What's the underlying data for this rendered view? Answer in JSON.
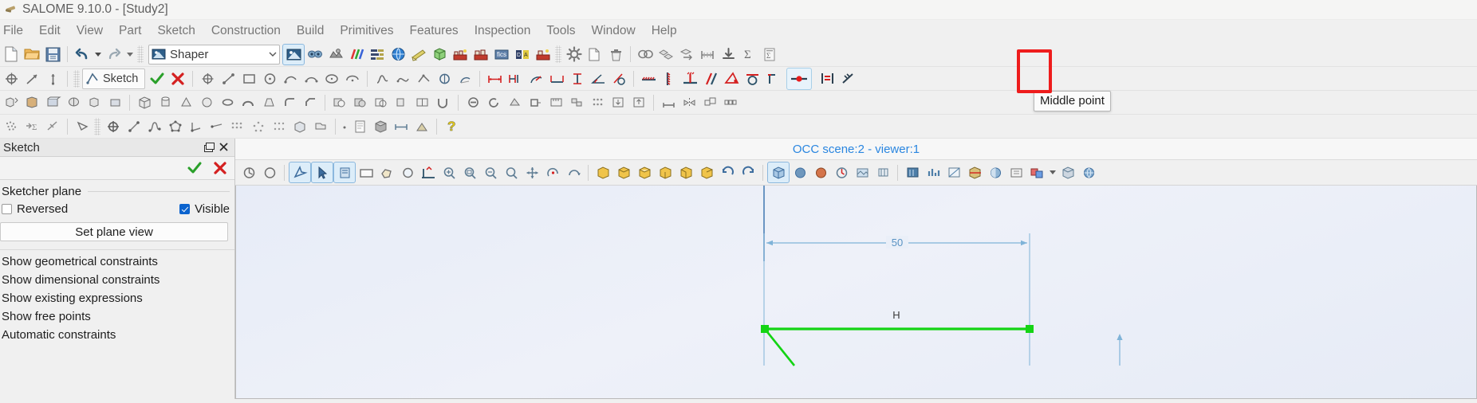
{
  "window": {
    "title": "SALOME 9.10.0 - [Study2]",
    "logo_icon": "salome-logo-icon"
  },
  "menubar": {
    "items": [
      {
        "label": "File"
      },
      {
        "label": "Edit"
      },
      {
        "label": "View"
      },
      {
        "label": "Part"
      },
      {
        "label": "Sketch"
      },
      {
        "label": "Construction"
      },
      {
        "label": "Build"
      },
      {
        "label": "Primitives"
      },
      {
        "label": "Features"
      },
      {
        "label": "Inspection"
      },
      {
        "label": "Tools"
      },
      {
        "label": "Window"
      },
      {
        "label": "Help"
      }
    ]
  },
  "toolbar_standard": {
    "new_tooltip": "New",
    "open_tooltip": "Open",
    "save_tooltip": "Save",
    "undo_tooltip": "Undo",
    "redo_tooltip": "Redo",
    "module_selector": {
      "value": "Shaper",
      "icon": "shaper-module-icon",
      "arrow_icon": "chevron-down-icon"
    },
    "module_icons": [
      {
        "name": "shaper-module-icon"
      },
      {
        "name": "geometry-module-icon"
      },
      {
        "name": "mesh-module-icon"
      },
      {
        "name": "paravis-module-icon"
      },
      {
        "name": "yacs-module-icon"
      },
      {
        "name": "jobmanager-module-icon"
      },
      {
        "name": "notebook-module-icon"
      },
      {
        "name": "shapergui-module-icon"
      },
      {
        "name": "homard-module-icon"
      },
      {
        "name": "eficas-module-icon"
      },
      {
        "name": "medcalc-module-icon"
      },
      {
        "name": "hexablock-module-icon"
      }
    ],
    "right_icons": [
      {
        "name": "preferences-gear-icon"
      },
      {
        "name": "copy-icon"
      },
      {
        "name": "delete-trash-icon"
      },
      {
        "name": "group-icon"
      },
      {
        "name": "duplicate-icon"
      },
      {
        "name": "transform-icon"
      },
      {
        "name": "measure-icon"
      },
      {
        "name": "export-icon"
      },
      {
        "name": "sum-sigma-icon"
      },
      {
        "name": "parameters-icon"
      }
    ]
  },
  "toolbar_sketch": {
    "left_icons": [
      {
        "name": "point-origin-icon"
      },
      {
        "name": "axis-icon"
      },
      {
        "name": "plane-icon"
      }
    ],
    "sketch_button": {
      "label": "Sketch",
      "icon": "sketch-icon",
      "accept_icon": "accept-check-icon",
      "reject_icon": "reject-cross-icon"
    },
    "draw_icons": [
      {
        "name": "point-icon"
      },
      {
        "name": "line-icon"
      },
      {
        "name": "rectangle-icon"
      },
      {
        "name": "circle-icon"
      },
      {
        "name": "arc-icon"
      },
      {
        "name": "arc-3points-icon"
      },
      {
        "name": "ellipse-icon"
      },
      {
        "name": "elliptic-arc-icon"
      },
      {
        "name": "bspline-icon"
      },
      {
        "name": "bspline-periodic-icon"
      },
      {
        "name": "interpolation-icon"
      },
      {
        "name": "circle-2-icon"
      },
      {
        "name": "arc-2-icon"
      },
      {
        "name": "fillet-icon"
      },
      {
        "name": "split-icon"
      },
      {
        "name": "trim-icon"
      },
      {
        "name": "offset-icon"
      },
      {
        "name": "mirror-icon"
      },
      {
        "name": "translation-icon"
      },
      {
        "name": "rotation-icon"
      }
    ],
    "dimension_icons": [
      {
        "name": "distance-icon"
      },
      {
        "name": "length-icon"
      },
      {
        "name": "radius-icon"
      },
      {
        "name": "horizontal-distance-icon"
      },
      {
        "name": "vertical-distance-icon"
      },
      {
        "name": "angle-icon"
      }
    ],
    "constraint_icons": [
      {
        "name": "horizontal-constraint-icon"
      },
      {
        "name": "vertical-constraint-icon"
      },
      {
        "name": "perpendicular-constraint-icon"
      },
      {
        "name": "parallel-constraint-icon"
      },
      {
        "name": "angle-constraint-icon"
      },
      {
        "name": "tangent-constraint-icon"
      },
      {
        "name": "coincident-constraint-icon"
      }
    ],
    "highlighted_button": {
      "name": "middle-point-button",
      "icon": "middle-point-icon",
      "tooltip": "Middle point",
      "annotation_color": "#ee1c1c",
      "hover_highlight": true
    },
    "after_highlight_icons": [
      {
        "name": "equal-constraint-icon"
      },
      {
        "name": "collinear-constraint-icon"
      }
    ]
  },
  "toolbar_features": {
    "icons": [
      {
        "name": "extrusion-icon"
      },
      {
        "name": "extrusion-cut-icon"
      },
      {
        "name": "extrusion-fuse-icon"
      },
      {
        "name": "revolution-icon"
      },
      {
        "name": "revolution-cut-icon"
      },
      {
        "name": "revolution-fuse-icon"
      },
      {
        "name": "box-icon"
      },
      {
        "name": "cylinder-icon"
      },
      {
        "name": "cone-icon"
      },
      {
        "name": "sphere-icon"
      },
      {
        "name": "torus-icon"
      },
      {
        "name": "pipe-icon"
      },
      {
        "name": "loft-icon"
      },
      {
        "name": "fillet-3d-icon"
      },
      {
        "name": "chamfer-icon"
      },
      {
        "name": "boolean-cut-icon"
      },
      {
        "name": "boolean-fuse-icon"
      },
      {
        "name": "boolean-common-icon"
      },
      {
        "name": "boolean-smash-icon"
      },
      {
        "name": "partition-icon"
      },
      {
        "name": "union-icon"
      },
      {
        "name": "remove-subshapes-icon"
      },
      {
        "name": "recover-icon"
      },
      {
        "name": "fill-icon"
      },
      {
        "name": "placement-icon"
      },
      {
        "name": "measurement-icon"
      },
      {
        "name": "group-feature-icon"
      },
      {
        "name": "field-icon"
      },
      {
        "name": "import-icon"
      },
      {
        "name": "export-shape-icon"
      }
    ]
  },
  "toolbar_view": {
    "icons": [
      {
        "name": "scatter-points-icon"
      },
      {
        "name": "sigma-expression-icon"
      },
      {
        "name": "filters-icon"
      },
      {
        "name": "polyline-icon"
      },
      {
        "name": "point-feature-icon"
      },
      {
        "name": "line-feature-icon"
      },
      {
        "name": "spline-feature-icon"
      },
      {
        "name": "polygon-feature-icon"
      },
      {
        "name": "angle-feature-icon"
      },
      {
        "name": "multi-point-icon"
      },
      {
        "name": "multi-translation-icon"
      },
      {
        "name": "multi-rotation-icon"
      },
      {
        "name": "box-solid-icon"
      },
      {
        "name": "import-file-icon"
      },
      {
        "name": "page-icon"
      },
      {
        "name": "rectangle-solid-icon"
      },
      {
        "name": "cube-solid-icon"
      },
      {
        "name": "circle-solid-icon"
      },
      {
        "name": "sphere-solid-icon"
      },
      {
        "name": "cone-solid-icon"
      },
      {
        "name": "cylinder-solid-icon"
      },
      {
        "name": "dot-icon"
      },
      {
        "name": "document-icon"
      },
      {
        "name": "cube-shaded-icon"
      },
      {
        "name": "dimension-icon"
      },
      {
        "name": "shading-icon"
      },
      {
        "name": "help-question-icon"
      }
    ]
  },
  "left_panel": {
    "title": "Sketch",
    "undock_icon": "undock-icon",
    "close_icon": "close-icon",
    "accept_icon": "accept-check-icon",
    "reject_icon": "reject-cross-icon",
    "group_title": "Sketcher plane",
    "checkboxes": [
      {
        "label": "Reversed",
        "checked": false,
        "name": "reversed-checkbox"
      },
      {
        "label": "Visible",
        "checked": true,
        "name": "visible-checkbox"
      }
    ],
    "set_plane_view_button": "Set plane view",
    "options": [
      {
        "label": "Show geometrical constraints"
      },
      {
        "label": "Show dimensional constraints"
      },
      {
        "label": "Show existing expressions"
      },
      {
        "label": "Show free points"
      },
      {
        "label": "Automatic constraints"
      }
    ]
  },
  "viewer": {
    "title": "OCC scene:2 - viewer:1",
    "title_color": "#2a86e0",
    "toolbar_icons": [
      {
        "name": "dump-view-icon"
      },
      {
        "name": "recording-icon"
      },
      {
        "name": "selection-mode-icon"
      },
      {
        "name": "arrow-cursor-icon"
      },
      {
        "name": "pan-icon"
      },
      {
        "name": "zoom-window-icon"
      },
      {
        "name": "polygon-select-icon"
      },
      {
        "name": "circle-select-icon"
      },
      {
        "name": "sketch-view-icon"
      },
      {
        "name": "fit-all-icon"
      },
      {
        "name": "fit-area-icon"
      },
      {
        "name": "zoom-icon"
      },
      {
        "name": "panning-icon"
      },
      {
        "name": "global-panning-icon"
      },
      {
        "name": "rotation-point-icon"
      },
      {
        "name": "rotation-icon"
      },
      {
        "name": "front-view-icon"
      },
      {
        "name": "back-view-icon"
      },
      {
        "name": "top-view-icon"
      },
      {
        "name": "bottom-view-icon"
      },
      {
        "name": "left-view-icon"
      },
      {
        "name": "right-view-icon"
      },
      {
        "name": "anticlockwise-icon"
      },
      {
        "name": "clockwise-icon"
      },
      {
        "name": "reset-view-icon"
      },
      {
        "name": "clone-view-icon"
      },
      {
        "name": "shoot-view-icon"
      },
      {
        "name": "ray-tracing-icon"
      },
      {
        "name": "environment-texture-icon"
      },
      {
        "name": "light-source-icon"
      },
      {
        "name": "graduated-axes-icon"
      },
      {
        "name": "update-rate-icon"
      },
      {
        "name": "scaling-icon"
      },
      {
        "name": "clipping-icon"
      },
      {
        "name": "shading-model-icon"
      },
      {
        "name": "view-parameters-icon"
      },
      {
        "name": "axis-cube-icon"
      },
      {
        "name": "orthographic-icon"
      },
      {
        "name": "perspective-icon"
      }
    ],
    "sketch_geometry": {
      "dimension_labels": [
        {
          "value": "50",
          "name": "horizontal-dimension-50"
        },
        {
          "value": "H",
          "name": "horizontal-constraint-marker"
        }
      ],
      "colors": {
        "construction": "#7fb3d8",
        "sketch_line": "#1bd41b",
        "vertex": "#1bd41b",
        "dimension": "#6fa8d0"
      }
    }
  }
}
